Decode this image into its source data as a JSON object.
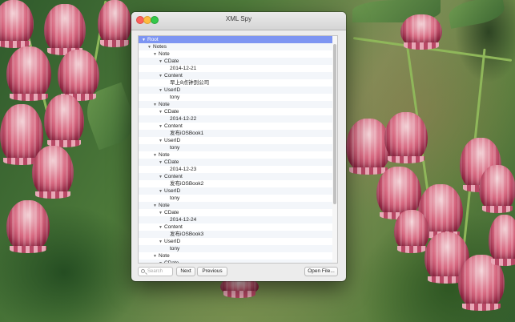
{
  "window": {
    "title": "XML Spy"
  },
  "tree": {
    "rows": [
      {
        "label": "Root",
        "indent": 0,
        "expanded": true,
        "selected": true
      },
      {
        "label": "Notes",
        "indent": 1,
        "expanded": true
      },
      {
        "label": "Note",
        "indent": 2,
        "expanded": true
      },
      {
        "label": "CDate",
        "indent": 3,
        "expanded": true
      },
      {
        "label": "2014-12-21",
        "indent": 4
      },
      {
        "label": "Content",
        "indent": 3,
        "expanded": true
      },
      {
        "label": "早上8点钟到公司",
        "indent": 4
      },
      {
        "label": "UserID",
        "indent": 3,
        "expanded": true
      },
      {
        "label": "tony",
        "indent": 4
      },
      {
        "label": "Note",
        "indent": 2,
        "expanded": true
      },
      {
        "label": "CDate",
        "indent": 3,
        "expanded": true
      },
      {
        "label": "2014-12-22",
        "indent": 4
      },
      {
        "label": "Content",
        "indent": 3,
        "expanded": true
      },
      {
        "label": "发布iOSBook1",
        "indent": 4
      },
      {
        "label": "UserID",
        "indent": 3,
        "expanded": true
      },
      {
        "label": "tony",
        "indent": 4
      },
      {
        "label": "Note",
        "indent": 2,
        "expanded": true
      },
      {
        "label": "CDate",
        "indent": 3,
        "expanded": true
      },
      {
        "label": "2014-12-23",
        "indent": 4
      },
      {
        "label": "Content",
        "indent": 3,
        "expanded": true
      },
      {
        "label": "发布iOSBook2",
        "indent": 4
      },
      {
        "label": "UserID",
        "indent": 3,
        "expanded": true
      },
      {
        "label": "tony",
        "indent": 4
      },
      {
        "label": "Note",
        "indent": 2,
        "expanded": true
      },
      {
        "label": "CDate",
        "indent": 3,
        "expanded": true
      },
      {
        "label": "2014-12-24",
        "indent": 4
      },
      {
        "label": "Content",
        "indent": 3,
        "expanded": true
      },
      {
        "label": "发布iOSBook3",
        "indent": 4
      },
      {
        "label": "UserID",
        "indent": 3,
        "expanded": true
      },
      {
        "label": "tony",
        "indent": 4
      },
      {
        "label": "Note",
        "indent": 2,
        "expanded": true
      },
      {
        "label": "CDate",
        "indent": 3,
        "expanded": true
      }
    ]
  },
  "toolbar": {
    "search_placeholder": "Search",
    "next_label": "Next",
    "previous_label": "Previous",
    "open_file_label": "Open File..."
  },
  "icons": {
    "expanded": "disclosure-triangle-down-icon",
    "search": "magnifier-icon"
  },
  "colors": {
    "selection": "#7d95f2",
    "close": "#fc605c",
    "minimize": "#fdbc40",
    "zoom": "#34c84a"
  }
}
